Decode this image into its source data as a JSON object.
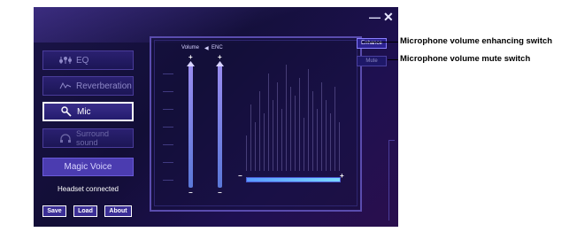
{
  "window_controls": {
    "minimize": "—",
    "close": "✕"
  },
  "sidebar": {
    "items": [
      {
        "label": "EQ",
        "icon": "eq-sliders-icon"
      },
      {
        "label": "Reverberation",
        "icon": "reverb-wave-icon"
      },
      {
        "label": "Mic",
        "icon": "microphone-icon"
      },
      {
        "label": "Surround sound",
        "icon": "headset-icon"
      }
    ],
    "magic_voice": "Magic Voice",
    "status": "Headset connected"
  },
  "footer": {
    "save": "Save",
    "load": "Load",
    "about": "About"
  },
  "mic_panel": {
    "volume_label": "Volume",
    "enc_label": "ENC",
    "plus": "+",
    "minus": "−",
    "volume_level": 0.99,
    "enc_level": 0.99,
    "monitor_level": 1.0
  },
  "buttons": {
    "enhance": "Enhance",
    "mute": "Mute"
  },
  "callouts": {
    "enhance": "Microphone volume enhancing switch",
    "mute": "Microphone volume mute switch"
  },
  "colors": {
    "accent": "#4b3cb0",
    "window_bg": "#1a1448",
    "slider": "#7a8cf0"
  }
}
